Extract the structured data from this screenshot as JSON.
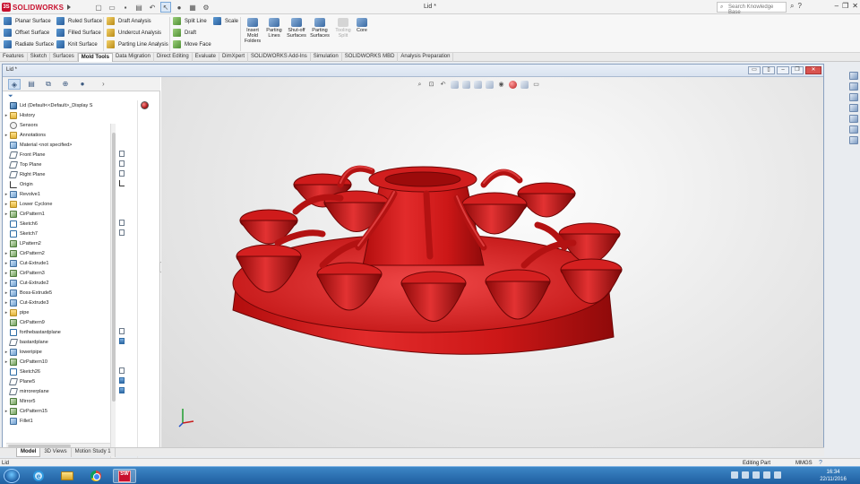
{
  "app": {
    "name": "SOLIDWORKS",
    "title": "Lid *"
  },
  "search": {
    "placeholder": "Search Knowledge Base"
  },
  "ribbon": {
    "col1": [
      "Planar Surface",
      "Offset Surface",
      "Radiate Surface"
    ],
    "col2": [
      "Ruled Surface",
      "Filled Surface",
      "Knit Surface"
    ],
    "col3": [
      "Draft Analysis",
      "Undercut Analysis",
      "Parting Line Analysis"
    ],
    "col4": [
      "Split Line",
      "Draft",
      "Move Face"
    ],
    "col5": [
      "Scale"
    ],
    "big": [
      "Insert Mold Folders",
      "Parting Lines",
      "Shut-off Surfaces",
      "Parting Surfaces",
      "Tooling Split",
      "Core"
    ]
  },
  "tabs": [
    "Features",
    "Sketch",
    "Surfaces",
    "Mold Tools",
    "Data Migration",
    "Direct Editing",
    "Evaluate",
    "DimXpert",
    "SOLIDWORKS Add-Ins",
    "Simulation",
    "SOLIDWORKS MBD",
    "Analysis Preparation"
  ],
  "active_tab": "Mold Tools",
  "docwin": {
    "title": "Lid *"
  },
  "tree": [
    {
      "label": "Lid  (Default<<Default>_Display S",
      "icon": "part",
      "exp": ""
    },
    {
      "label": "History",
      "icon": "folder",
      "exp": "▸"
    },
    {
      "label": "Sensors",
      "icon": "sens",
      "exp": ""
    },
    {
      "label": "Annotations",
      "icon": "folder",
      "exp": "▸"
    },
    {
      "label": "Material <not specified>",
      "icon": "feat",
      "exp": ""
    },
    {
      "label": "Front Plane",
      "icon": "plane",
      "exp": ""
    },
    {
      "label": "Top Plane",
      "icon": "plane",
      "exp": ""
    },
    {
      "label": "Right Plane",
      "icon": "plane",
      "exp": ""
    },
    {
      "label": "Origin",
      "icon": "orig",
      "exp": ""
    },
    {
      "label": "Revolve1",
      "icon": "feat",
      "exp": "▸"
    },
    {
      "label": "Lower Cyclone",
      "icon": "folder",
      "exp": "▸"
    },
    {
      "label": "CirPattern1",
      "icon": "pat",
      "exp": "▸"
    },
    {
      "label": "Sketch6",
      "icon": "sketch",
      "exp": ""
    },
    {
      "label": "Sketch7",
      "icon": "sketch",
      "exp": ""
    },
    {
      "label": "LPattern2",
      "icon": "pat",
      "exp": ""
    },
    {
      "label": "CirPattern2",
      "icon": "pat",
      "exp": "▸"
    },
    {
      "label": "Cut-Extrude1",
      "icon": "feat",
      "exp": "▸"
    },
    {
      "label": "CirPattern3",
      "icon": "pat",
      "exp": "▸"
    },
    {
      "label": "Cut-Extrude2",
      "icon": "feat",
      "exp": "▸"
    },
    {
      "label": "Boss-Extrude5",
      "icon": "feat",
      "exp": "▸"
    },
    {
      "label": "Cut-Extrude3",
      "icon": "feat",
      "exp": "▸"
    },
    {
      "label": "pipe",
      "icon": "folder",
      "exp": "▸"
    },
    {
      "label": "CirPattern9",
      "icon": "pat",
      "exp": ""
    },
    {
      "label": "forthebastardplane",
      "icon": "sketch",
      "exp": ""
    },
    {
      "label": "bastardplane",
      "icon": "plane",
      "exp": ""
    },
    {
      "label": "loweripipe",
      "icon": "feat",
      "exp": "▸"
    },
    {
      "label": "CirPattern10",
      "icon": "pat",
      "exp": "▸"
    },
    {
      "label": "Sketch26",
      "icon": "sketch",
      "exp": ""
    },
    {
      "label": "Plane5",
      "icon": "plane",
      "exp": ""
    },
    {
      "label": "mirrorerplane",
      "icon": "plane",
      "exp": ""
    },
    {
      "label": "Mirror5",
      "icon": "pat",
      "exp": ""
    },
    {
      "label": "CirPattern15",
      "icon": "pat",
      "exp": "▸"
    },
    {
      "label": "Fillet1",
      "icon": "feat",
      "exp": ""
    }
  ],
  "model_tabs": [
    "Model",
    "3D Views",
    "Motion Study 1"
  ],
  "active_model_tab": "Model",
  "status": {
    "left": "Lid",
    "mode": "Editing Part",
    "units": "MMGS"
  },
  "clock": {
    "time": "16:34",
    "date": "22/11/2016"
  },
  "colors": {
    "part_red": "#d21a1a",
    "brand": "#c8102e",
    "taskbar": "#1f5fa0"
  }
}
